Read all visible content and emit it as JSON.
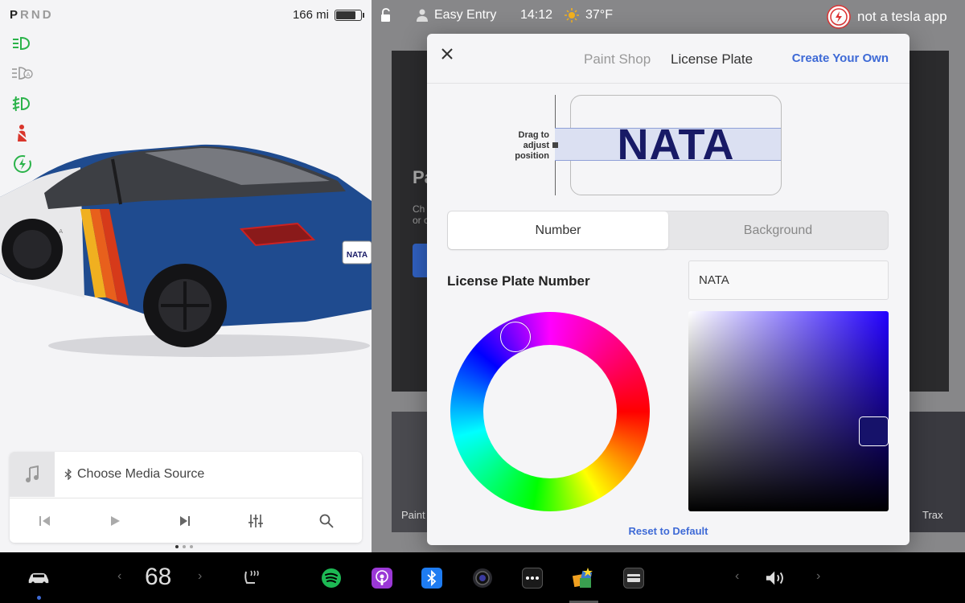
{
  "left": {
    "gear": {
      "letters": [
        "P",
        "R",
        "N",
        "D"
      ],
      "active": "P"
    },
    "range": "166 mi",
    "battery_level": 0.8,
    "telltales": [
      "headlights-on-icon",
      "auto-high-beam-icon",
      "fog-light-icon",
      "seatbelt-warning-icon",
      "regen-icon"
    ],
    "car": {
      "badge": "TESLA",
      "plate": "NATA"
    },
    "media": {
      "source_label": "Choose Media Source"
    },
    "page_dots": 3,
    "active_dot": 0
  },
  "status": {
    "profile": "Easy Entry",
    "time": "14:12",
    "temperature": "37°F",
    "brand": "not a tesla app"
  },
  "background": {
    "heading": "Pa",
    "sub1": "Ch",
    "sub2": "or c",
    "tile_left": "Paint",
    "tile_right": "Trax"
  },
  "modal": {
    "tabs": {
      "paint_shop": "Paint Shop",
      "license_plate": "License Plate"
    },
    "create_link": "Create Your Own",
    "drag_hint": "Drag to adjust position",
    "plate_text": "NATA",
    "segments": {
      "number": "Number",
      "background": "Background"
    },
    "plate_number_label": "License Plate Number",
    "plate_number_value": "NATA",
    "reset_label": "Reset to Default",
    "selected_color": "#16126a"
  },
  "taskbar": {
    "temperature": "68",
    "apps": [
      "car-icon",
      "seat-heat-icon",
      "spotify-icon",
      "podcasts-icon",
      "bluetooth-icon",
      "camera-icon",
      "more-icon",
      "toybox-icon",
      "dashcam-icon",
      "volume-icon"
    ]
  }
}
